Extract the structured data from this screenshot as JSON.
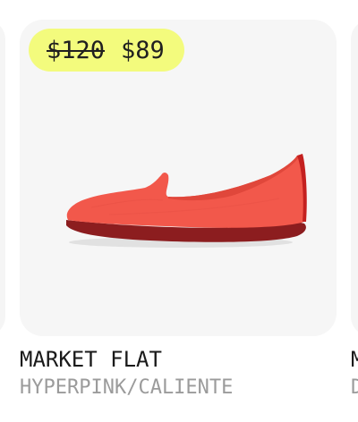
{
  "product": {
    "price_original": "$120",
    "price_sale": "$89",
    "name": "MARKET FLAT",
    "colorway": "HYPERPINK/CALIENTE",
    "image_icon": "red-slip-on-flat-shoe"
  },
  "next_product": {
    "name_partial": "M",
    "colorway_partial": "D"
  },
  "colors": {
    "price_pill": "#f3fb7d",
    "shoe_upper": "#f2584b",
    "shoe_sole": "#8c1d1f",
    "card_background": "#f6f6f6"
  }
}
